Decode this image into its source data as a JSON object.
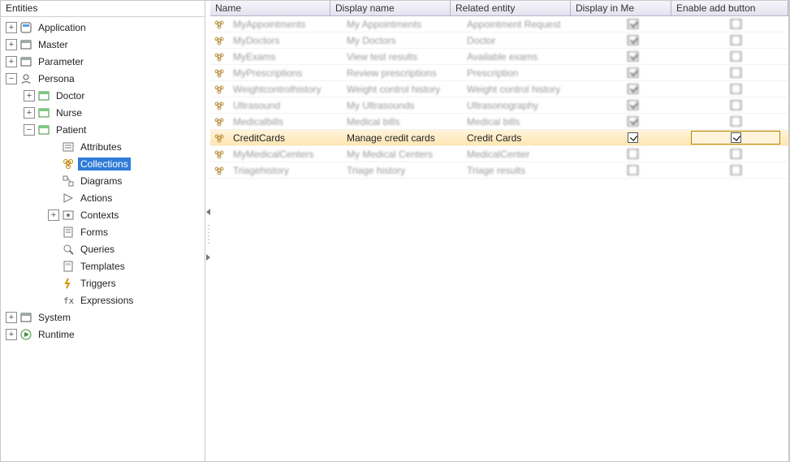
{
  "tree": {
    "header": "Entities",
    "nodes": [
      {
        "id": "app",
        "label": "Application",
        "depth": 0,
        "exp": "plus",
        "icon": "app"
      },
      {
        "id": "master",
        "label": "Master",
        "depth": 0,
        "exp": "plus",
        "icon": "master"
      },
      {
        "id": "param",
        "label": "Parameter",
        "depth": 0,
        "exp": "plus",
        "icon": "master"
      },
      {
        "id": "persona",
        "label": "Persona",
        "depth": 0,
        "exp": "minus",
        "icon": "persona"
      },
      {
        "id": "doctor",
        "label": "Doctor",
        "depth": 1,
        "exp": "plus",
        "icon": "entity"
      },
      {
        "id": "nurse",
        "label": "Nurse",
        "depth": 1,
        "exp": "plus",
        "icon": "entity"
      },
      {
        "id": "patient",
        "label": "Patient",
        "depth": 1,
        "exp": "minus",
        "icon": "entity"
      },
      {
        "id": "attrs",
        "label": "Attributes",
        "depth": 2,
        "exp": "none",
        "icon": "attrs"
      },
      {
        "id": "colls",
        "label": "Collections",
        "depth": 2,
        "exp": "none",
        "icon": "colls",
        "selected": true
      },
      {
        "id": "diags",
        "label": "Diagrams",
        "depth": 2,
        "exp": "none",
        "icon": "diag"
      },
      {
        "id": "actions",
        "label": "Actions",
        "depth": 2,
        "exp": "none",
        "icon": "action"
      },
      {
        "id": "contexts",
        "label": "Contexts",
        "depth": 2,
        "exp": "plus",
        "icon": "ctx"
      },
      {
        "id": "forms",
        "label": "Forms",
        "depth": 2,
        "exp": "none",
        "icon": "form"
      },
      {
        "id": "queries",
        "label": "Queries",
        "depth": 2,
        "exp": "none",
        "icon": "query"
      },
      {
        "id": "templates",
        "label": "Templates",
        "depth": 2,
        "exp": "none",
        "icon": "tmpl"
      },
      {
        "id": "triggers",
        "label": "Triggers",
        "depth": 2,
        "exp": "none",
        "icon": "trig"
      },
      {
        "id": "exprs",
        "label": "Expressions",
        "depth": 2,
        "exp": "none",
        "icon": "expr"
      },
      {
        "id": "system",
        "label": "System",
        "depth": 0,
        "exp": "plus",
        "icon": "master"
      },
      {
        "id": "runtime",
        "label": "Runtime",
        "depth": 0,
        "exp": "plus",
        "icon": "runtime"
      }
    ]
  },
  "grid": {
    "headers": {
      "name": "Name",
      "display": "Display name",
      "related": "Related entity",
      "dm": "Display in Me",
      "eab": "Enable add button"
    },
    "rows": [
      {
        "name": "MyAppointments",
        "display": "My Appointments",
        "related": "Appointment Request",
        "dm": true,
        "eab": false,
        "blur": true
      },
      {
        "name": "MyDoctors",
        "display": "My Doctors",
        "related": "Doctor",
        "dm": true,
        "eab": false,
        "blur": true
      },
      {
        "name": "MyExams",
        "display": "View test results",
        "related": "Available exams",
        "dm": true,
        "eab": false,
        "blur": true
      },
      {
        "name": "MyPrescriptions",
        "display": "Review prescriptions",
        "related": "Prescription",
        "dm": true,
        "eab": false,
        "blur": true
      },
      {
        "name": "Weightcontrolhistory",
        "display": "Weight control history",
        "related": "Weight control history",
        "dm": true,
        "eab": false,
        "blur": true
      },
      {
        "name": "Ultrasound",
        "display": "My Ultrasounds",
        "related": "Ultrasonography",
        "dm": true,
        "eab": false,
        "blur": true
      },
      {
        "name": "Medicalbills",
        "display": "Medical bills",
        "related": "Medical bills",
        "dm": true,
        "eab": false,
        "blur": true
      },
      {
        "name": "CreditCards",
        "display": "Manage credit cards",
        "related": "Credit Cards",
        "dm": true,
        "eab": true,
        "blur": false,
        "focus": true
      },
      {
        "name": "MyMedicalCenters",
        "display": "My Medical Centers",
        "related": "MedicalCenter",
        "dm": false,
        "eab": false,
        "blur": true
      },
      {
        "name": "Triagehistory",
        "display": "Triage history",
        "related": "Triage results",
        "dm": false,
        "eab": false,
        "blur": true
      }
    ]
  }
}
